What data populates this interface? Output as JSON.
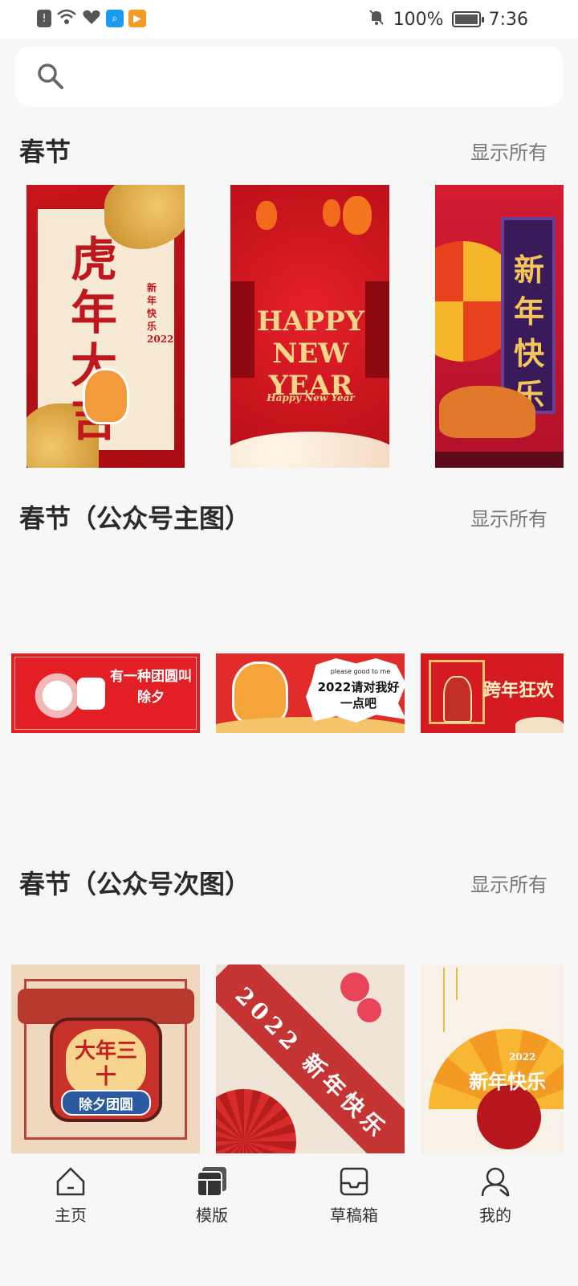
{
  "status_bar": {
    "battery": "100%",
    "time": "7:36",
    "icons": [
      "alert-icon",
      "wifi-icon",
      "heart-rate-icon",
      "search-app-icon",
      "video-app-icon",
      "bell-off-icon",
      "battery-icon"
    ]
  },
  "search": {
    "placeholder": ""
  },
  "sections": [
    {
      "title": "春节",
      "show_all": "显示所有",
      "cards": [
        {
          "name": "tiger-year-poster",
          "text": "虎年大吉",
          "sub": "新年快乐 2022"
        },
        {
          "name": "happy-new-year-poster",
          "text": "HAPPY NEW YEAR",
          "sub": "Happy New Year"
        },
        {
          "name": "xin-nian-kuai-le-poster",
          "text": "新年快乐",
          "sub": ""
        }
      ]
    },
    {
      "title": "春节（公众号主图）",
      "show_all": "显示所有",
      "cards": [
        {
          "name": "reunion-banner",
          "text": "有一种团圆叫 除夕",
          "sub": ""
        },
        {
          "name": "tiger-banner",
          "text": "2022请对我好一点吧",
          "sub": "please good to me"
        },
        {
          "name": "kuanian-banner",
          "text": "跨年狂欢",
          "sub": ""
        }
      ]
    },
    {
      "title": "春节（公众号次图）",
      "show_all": "显示所有",
      "cards": [
        {
          "name": "chuxi-square",
          "text": "大年三十",
          "sub": "除夕团圆"
        },
        {
          "name": "2022-square",
          "text": "2022 新年快乐",
          "sub": ""
        },
        {
          "name": "fan-square",
          "text": "新年快乐",
          "sub": "2022"
        }
      ]
    }
  ],
  "nav": [
    {
      "label": "主页",
      "icon": "home-icon"
    },
    {
      "label": "模版",
      "icon": "templates-icon"
    },
    {
      "label": "草稿箱",
      "icon": "drafts-icon"
    },
    {
      "label": "我的",
      "icon": "profile-icon"
    }
  ]
}
